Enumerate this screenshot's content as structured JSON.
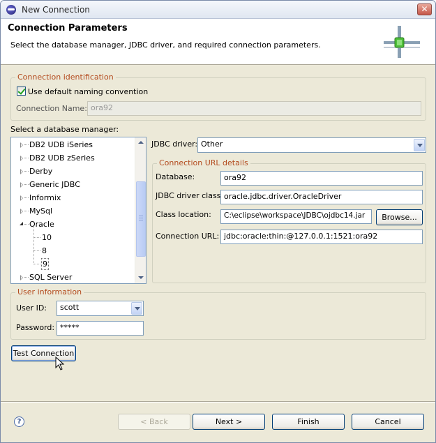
{
  "window": {
    "title": "New Connection",
    "close_glyph": "✕"
  },
  "header": {
    "title": "Connection Parameters",
    "description": "Select the database manager, JDBC driver, and required connection parameters.",
    "graphic": "database-connector-graphic"
  },
  "identification": {
    "group_label": "Connection identification",
    "use_default_label": "Use default naming convention",
    "use_default_checked": true,
    "name_label": "Connection Name:",
    "name_value": "ora92"
  },
  "db_manager": {
    "label": "Select a database manager:",
    "items": [
      {
        "label": "DB2 UDB iSeries",
        "expanded": false
      },
      {
        "label": "DB2 UDB zSeries",
        "expanded": false
      },
      {
        "label": "Derby",
        "expanded": false
      },
      {
        "label": "Generic JDBC",
        "expanded": false
      },
      {
        "label": "Informix",
        "expanded": false
      },
      {
        "label": "MySql",
        "expanded": false
      },
      {
        "label": "Oracle",
        "expanded": true
      },
      {
        "label": "10",
        "child": true
      },
      {
        "label": "8",
        "child": true
      },
      {
        "label": "9",
        "child": true,
        "selected": true
      },
      {
        "label": "SQL Server",
        "expanded": false
      }
    ]
  },
  "jdbc": {
    "driver_label": "JDBC driver:",
    "driver_value": "Other"
  },
  "url_details": {
    "group_label": "Connection URL details",
    "database_label": "Database:",
    "database_value": "ora92",
    "driver_class_label": "JDBC driver class:",
    "driver_class_value": "oracle.jdbc.driver.OracleDriver",
    "class_location_label": "Class location:",
    "class_location_value": "C:\\eclipse\\workspace\\JDBC\\ojdbc14.jar",
    "browse_label": "Browse...",
    "connection_url_label": "Connection URL:",
    "connection_url_value": "jdbc:oracle:thin:@127.0.0.1:1521:ora92"
  },
  "user_info": {
    "group_label": "User information",
    "user_id_label": "User ID:",
    "user_id_value": "scott",
    "password_label": "Password:",
    "password_value": "*****"
  },
  "test_connection_label": "Test Connection",
  "footer": {
    "help_glyph": "?",
    "back_label": "< Back",
    "next_label": "Next >",
    "finish_label": "Finish",
    "cancel_label": "Cancel"
  }
}
